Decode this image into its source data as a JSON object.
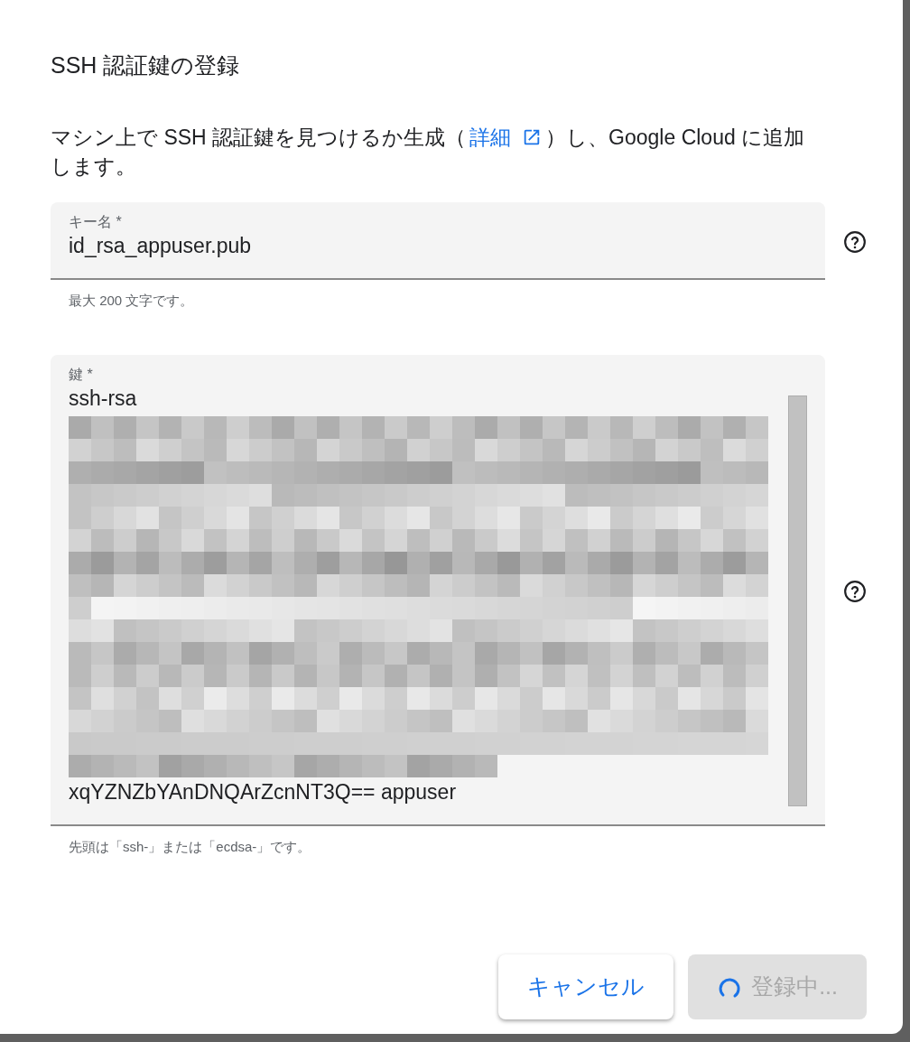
{
  "dialog": {
    "title": "SSH 認証鍵の登録",
    "description": {
      "before": "マシン上で SSH 認証鍵を見つけるか生成（",
      "link": "詳細",
      "after": "）し、Google Cloud に追加します。"
    },
    "fields": [
      {
        "kind": "input",
        "label": "キー名 *",
        "value": "id_rsa_appuser.pub",
        "hint": "最大 200 文字です。"
      },
      {
        "kind": "textarea",
        "label": "鍵 *",
        "first_line": "ssh-rsa",
        "redacted": true,
        "last_line": "xqYZNZbYAnDNQArZcnNT3Q== appuser",
        "hint": "先頭は「ssh-」または「ecdsa-」です。"
      }
    ],
    "buttons": [
      {
        "label": "キャンセル",
        "disabled": false,
        "loading": false
      },
      {
        "label": "登録中...",
        "disabled": true,
        "loading": true
      }
    ]
  }
}
